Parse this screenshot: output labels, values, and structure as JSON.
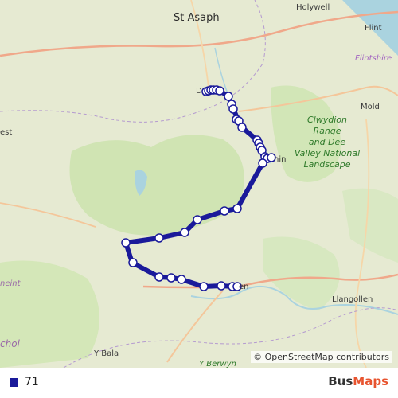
{
  "map": {
    "places": [
      {
        "id": "st-asaph",
        "label": "St Asaph"
      },
      {
        "id": "holywell",
        "label": "Holywell"
      },
      {
        "id": "flint",
        "label": "Flint"
      },
      {
        "id": "mold",
        "label": "Mold"
      },
      {
        "id": "llangollen",
        "label": "Llangollen"
      },
      {
        "id": "y-bala",
        "label": "Y Bala"
      },
      {
        "id": "denbigh-partial",
        "label": "D"
      },
      {
        "id": "ruthin-partial",
        "label": "hin"
      },
      {
        "id": "corwen-partial",
        "label": "en"
      },
      {
        "id": "west-edge-partial",
        "label": "est"
      },
      {
        "id": "meirionnydd-partial",
        "label": "neint"
      },
      {
        "id": "chol-partial",
        "label": "chol"
      },
      {
        "id": "y-berwyn-partial",
        "label": "Y Berwyn"
      }
    ],
    "regions": [
      {
        "id": "flintshire",
        "label": "Flintshire"
      }
    ],
    "national_park": {
      "lines": [
        "Clwydion",
        "Range",
        "and Dee",
        "Valley National",
        "Landscape"
      ]
    },
    "attribution": "© OpenStreetMap contributors",
    "route_color": "#1a1a9a",
    "stop_fill": "#ffffff"
  },
  "legend": {
    "route_label": "71",
    "route_color": "#1a1a9a"
  },
  "logo": {
    "part1": "Bus",
    "part2": "Maps"
  }
}
